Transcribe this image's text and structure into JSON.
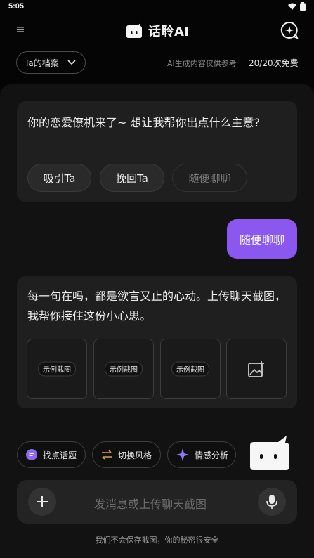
{
  "status_bar": {
    "time": "5:05",
    "icons": [
      "wifi-icon",
      "battery-icon"
    ]
  },
  "header": {
    "app_name": "话聆AI",
    "icons": {
      "menu": "menu-icon",
      "logo": "chat-bubble-logo-icon",
      "new_chat": "new-chat-sparkle-icon"
    }
  },
  "toolbar": {
    "profile_label": "Ta的档案",
    "disclaimer": "AI生成内容仅供参考",
    "quota": "20/20次免费"
  },
  "conversation": {
    "ai_message_1": "你的恋爱僚机来了~ 想让我帮你出点什么主意?",
    "chips": [
      {
        "label": "吸引Ta",
        "enabled": true
      },
      {
        "label": "挽回Ta",
        "enabled": true
      },
      {
        "label": "随便聊聊",
        "enabled": false
      }
    ],
    "user_message": "随便聊聊",
    "ai_message_2": "每一句在吗，都是欲言又止的心动。上传聊天截图，我帮你接住这份小心思。",
    "thumbnails": [
      "示例截图",
      "示例截图",
      "示例截图"
    ],
    "upload_icon": "add-image-icon"
  },
  "quick_actions": [
    {
      "label": "找点话题",
      "icon": "topic-bubble-icon",
      "color": "#8b6cf0"
    },
    {
      "label": "切换风格",
      "icon": "swap-arrows-icon",
      "color": "#e0a040"
    },
    {
      "label": "情感分析",
      "icon": "sparkle-icon",
      "color": "#8e7cf6"
    }
  ],
  "composer": {
    "placeholder": "发消息或上传聊天截图",
    "icons": {
      "add": "plus-icon",
      "voice": "microphone-icon"
    }
  },
  "footer_note": "我们不会保存截图，你的秘密很安全",
  "colors": {
    "accent": "#8a58ee",
    "background": "#050505",
    "panel": "#121212",
    "bubble": "#1f1f1f"
  }
}
